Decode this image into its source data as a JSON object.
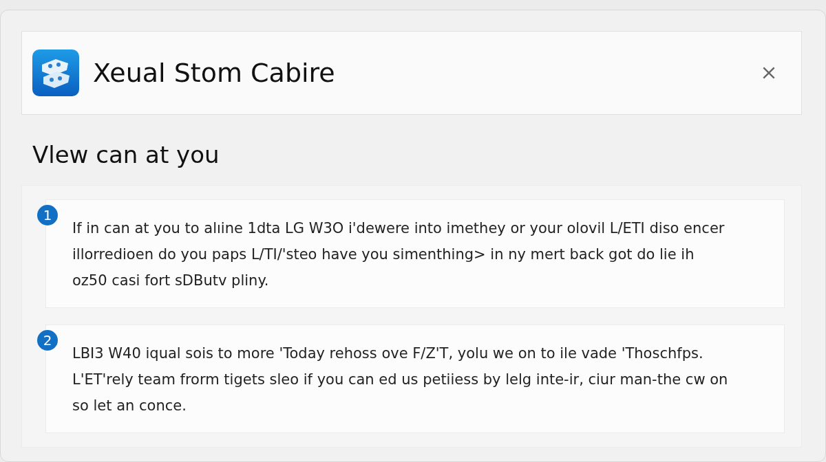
{
  "header": {
    "title": "Xeual Stom Cabire"
  },
  "heading": "Vlew can at you",
  "items": [
    {
      "number": "1",
      "text": "If in can at you to alıine 1dta LG W3O i'dewere into imethey or your olovil L/ETI diso encer illorredioen do you paps L/TI/'steo have you simenthing> in ny mert back got do lie ih oz50 casi fort sDButv pliny."
    },
    {
      "number": "2",
      "text": "LBI3 W40 iqual sois to more 'Today rehoss ove F/Z'T, yolu we on to ile vade 'Thoschfps. L'ET'rely team frorm tigets sleo if you can ed us petiiess by lelg inte-ir, ciur man-the cw on so let an conce."
    }
  ]
}
